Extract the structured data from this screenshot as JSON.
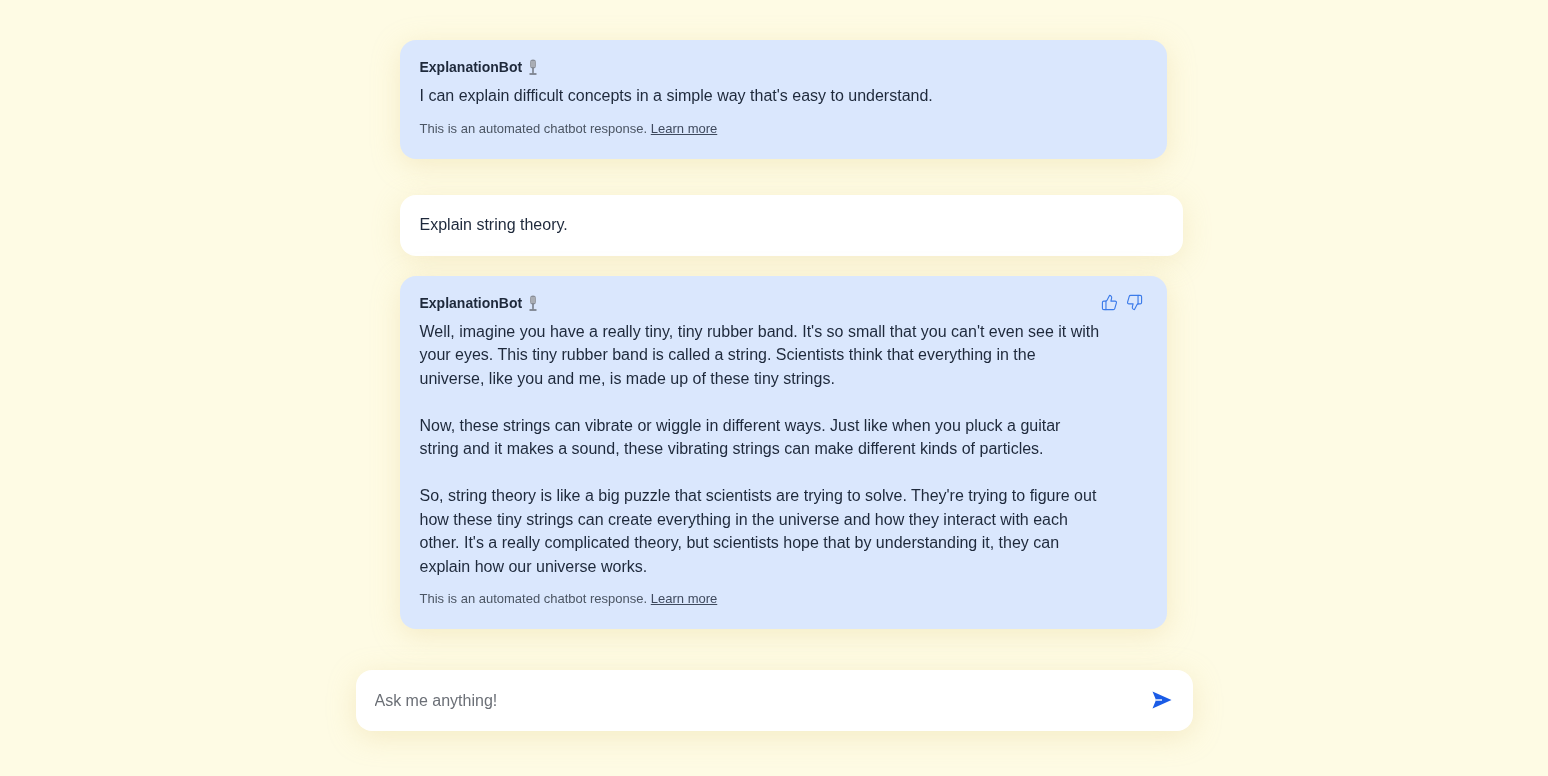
{
  "messages": [
    {
      "kind": "bot",
      "sender": "ExplanationBot",
      "paragraphs": [
        "I can explain difficult concepts in a simple way that's easy to understand."
      ],
      "disclaimer": "This is an automated chatbot response.",
      "link": "Learn more",
      "feedback": false
    },
    {
      "kind": "user",
      "text": "Explain string theory."
    },
    {
      "kind": "bot",
      "sender": "ExplanationBot",
      "paragraphs": [
        "Well, imagine you have a really tiny, tiny rubber band. It's so small that you can't even see it with your eyes. This tiny rubber band is called a string. Scientists think that everything in the universe, like you and me, is made up of these tiny strings.",
        "Now, these strings can vibrate or wiggle in different ways. Just like when you pluck a guitar string and it makes a sound, these vibrating strings can make different kinds of particles.",
        "So, string theory is like a big puzzle that scientists are trying to solve. They're trying to figure out how these tiny strings can create everything in the universe and how they interact with each other. It's a really complicated theory, but scientists hope that by understanding it, they can explain how our universe works."
      ],
      "disclaimer": "This is an automated chatbot response.",
      "link": "Learn more",
      "feedback": true
    }
  ],
  "composer": {
    "placeholder": "Ask me anything!"
  }
}
